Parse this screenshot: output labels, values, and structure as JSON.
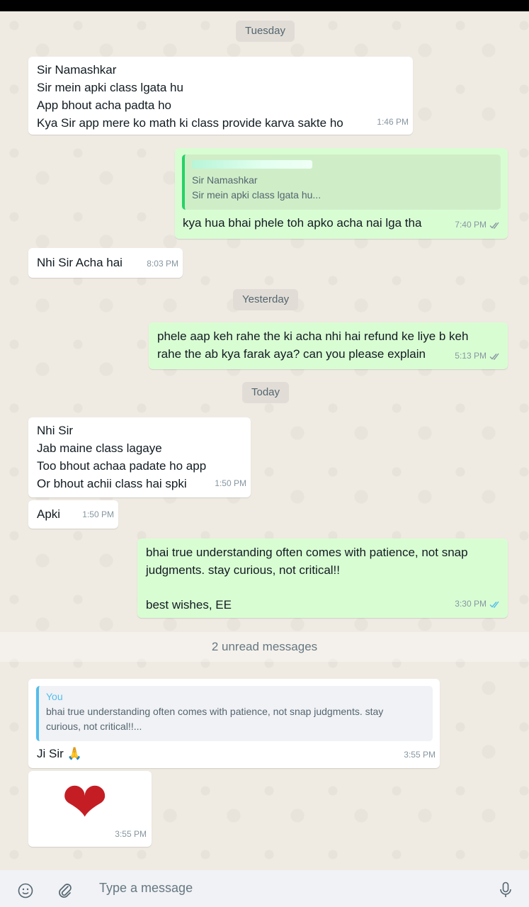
{
  "dates": {
    "tuesday": "Tuesday",
    "yesterday": "Yesterday",
    "today": "Today"
  },
  "messages": {
    "m1": {
      "lines": [
        "Sir Namashkar",
        "Sir mein apki class lgata hu",
        "App bhout acha padta ho",
        "Kya Sir app mere ko math ki class provide karva sakte ho"
      ],
      "time": "1:46 PM"
    },
    "m2": {
      "quote_lines": [
        "Sir Namashkar",
        "Sir mein apki class lgata hu..."
      ],
      "text": "kya hua bhai phele toh apko acha nai lga tha",
      "time": "7:40 PM"
    },
    "m3": {
      "text": "Nhi Sir Acha hai",
      "time": "8:03 PM"
    },
    "m4": {
      "lines": [
        "phele aap keh rahe the ki acha nhi hai refund ke liye b keh",
        "rahe the ab kya farak aya? can you please explain"
      ],
      "time": "5:13 PM"
    },
    "m5": {
      "lines": [
        "Nhi Sir",
        "Jab maine class lagaye",
        "Too bhout achaa padate ho app",
        "Or bhout achii class hai spki"
      ],
      "time": "1:50 PM"
    },
    "m6": {
      "text": "Apki",
      "time": "1:50 PM"
    },
    "m7": {
      "lines": [
        "bhai true understanding often comes with patience, not snap",
        "judgments. stay curious, not critical!!",
        "best wishes, EE"
      ],
      "time": "3:30 PM"
    },
    "m8": {
      "quote_author": "You",
      "quote_lines": [
        "bhai true understanding often comes with patience, not snap judgments. stay",
        "curious, not critical!!..."
      ],
      "text": "Ji Sir 🙏",
      "time": "3:55 PM"
    },
    "m9": {
      "sticker": "❤",
      "time": "3:55 PM"
    }
  },
  "unread_label": "2 unread messages",
  "input": {
    "placeholder": "Type a message"
  },
  "icons": [
    "emoji-icon",
    "attach-icon",
    "mic-icon",
    "double-check-icon"
  ],
  "colors": {
    "incoming": "#ffffff",
    "outgoing": "#d9fdd3",
    "read_ticks": "#53bdeb",
    "delivered_ticks": "#8696a0"
  }
}
